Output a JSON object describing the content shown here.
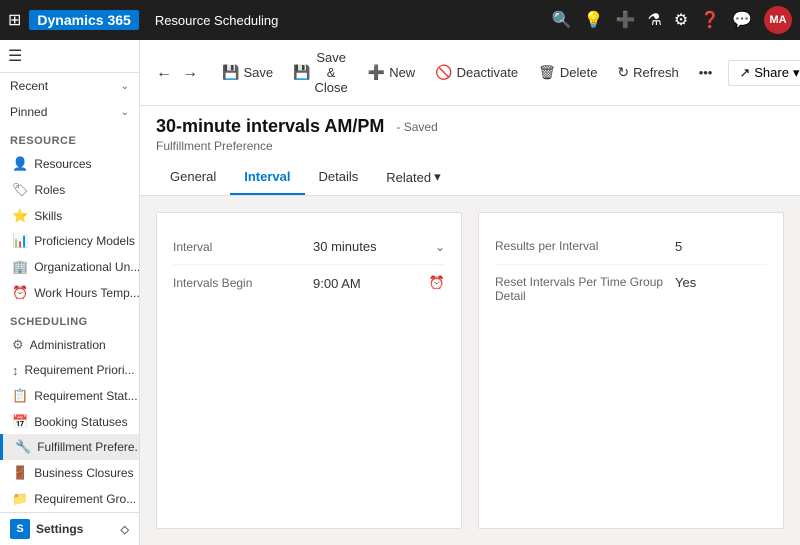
{
  "topNav": {
    "appName": "Dynamics 365",
    "moduleName": "Resource Scheduling",
    "avatarText": "MA"
  },
  "sidebar": {
    "hamburgerIcon": "☰",
    "recentLabel": "Recent",
    "pinnedLabel": "Pinned",
    "resourceGroup": "Resource",
    "items": [
      {
        "id": "resources",
        "label": "Resources",
        "icon": "👤"
      },
      {
        "id": "roles",
        "label": "Roles",
        "icon": "🏷"
      },
      {
        "id": "skills",
        "label": "Skills",
        "icon": "⭐"
      },
      {
        "id": "proficiency",
        "label": "Proficiency Models",
        "icon": "📊"
      },
      {
        "id": "org-units",
        "label": "Organizational Un...",
        "icon": "🏢"
      },
      {
        "id": "work-hours",
        "label": "Work Hours Temp...",
        "icon": "⏰"
      }
    ],
    "schedulingGroup": "Scheduling",
    "schedulingItems": [
      {
        "id": "administration",
        "label": "Administration",
        "icon": "⚙"
      },
      {
        "id": "req-priority",
        "label": "Requirement Priori...",
        "icon": "↕"
      },
      {
        "id": "req-status",
        "label": "Requirement Stat...",
        "icon": "📋"
      },
      {
        "id": "booking-statuses",
        "label": "Booking Statuses",
        "icon": "📅"
      },
      {
        "id": "fulfillment",
        "label": "Fulfillment Prefere...",
        "icon": "🔧",
        "active": true
      },
      {
        "id": "business-closures",
        "label": "Business Closures",
        "icon": "🚪"
      },
      {
        "id": "req-groups",
        "label": "Requirement Gro...",
        "icon": "📁"
      }
    ],
    "settingsLabel": "Settings",
    "settingsIcon": "S"
  },
  "toolbar": {
    "backIcon": "←",
    "forwardIcon": "→",
    "saveLabel": "Save",
    "saveCloseLabel": "Save & Close",
    "newLabel": "New",
    "deactivateLabel": "Deactivate",
    "deleteLabel": "Delete",
    "refreshLabel": "Refresh",
    "moreIcon": "•••",
    "shareLabel": "Share",
    "shareDropIcon": "▾",
    "windowIcon": "⊡"
  },
  "pageHeader": {
    "title": "30-minute intervals AM/PM",
    "savedLabel": "- Saved",
    "subtitle": "Fulfillment Preference"
  },
  "tabs": [
    {
      "id": "general",
      "label": "General"
    },
    {
      "id": "interval",
      "label": "Interval",
      "active": true
    },
    {
      "id": "details",
      "label": "Details"
    },
    {
      "id": "related",
      "label": "Related",
      "hasDropdown": true
    }
  ],
  "intervalForm": {
    "fields": [
      {
        "label": "Interval",
        "value": "30 minutes",
        "hasDropdown": true
      },
      {
        "label": "Intervals Begin",
        "value": "9:00 AM",
        "hasClock": true
      }
    ]
  },
  "resultsForm": {
    "fields": [
      {
        "label": "Results per Interval",
        "value": "5"
      },
      {
        "label": "Reset Intervals Per Time Group Detail",
        "value": "Yes"
      }
    ]
  }
}
